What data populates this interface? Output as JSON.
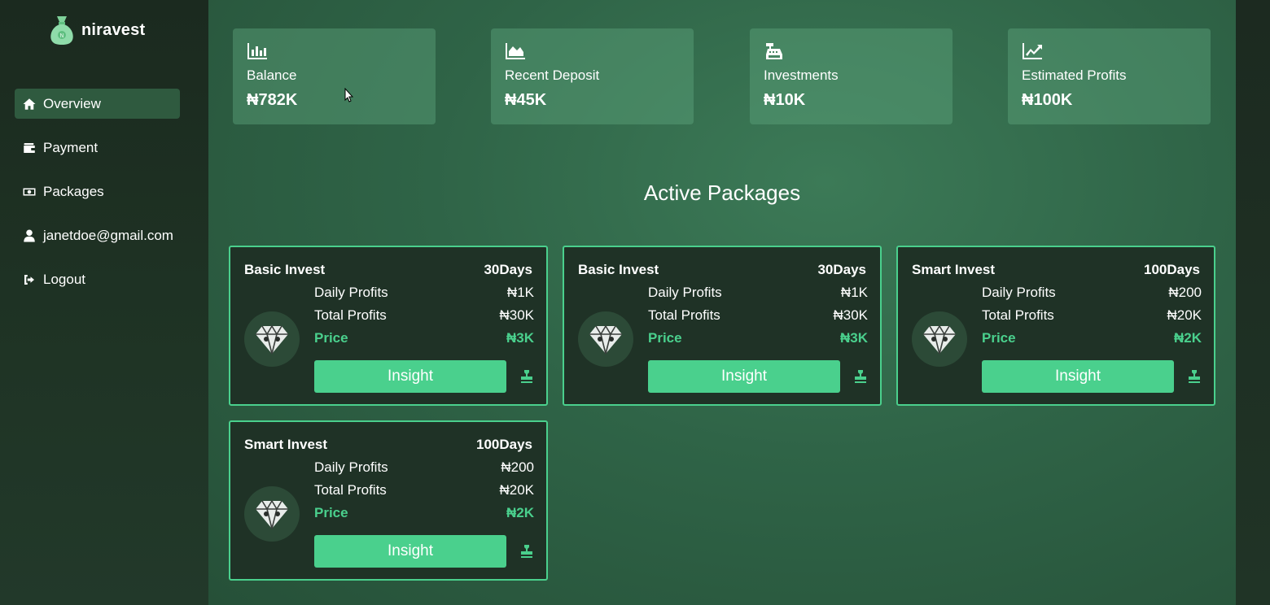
{
  "brand": {
    "name": "niravest",
    "logo_icon": "money-bag-icon"
  },
  "sidebar": {
    "items": [
      {
        "label": "Overview",
        "icon": "home-icon",
        "active": true
      },
      {
        "label": "Payment",
        "icon": "wallet-icon",
        "active": false
      },
      {
        "label": "Packages",
        "icon": "money-bill-icon",
        "active": false
      },
      {
        "label": "janetdoe@gmail.com",
        "icon": "user-icon",
        "active": false
      },
      {
        "label": "Logout",
        "icon": "logout-icon",
        "active": false
      }
    ]
  },
  "stats": [
    {
      "label": "Balance",
      "value": "₦782K",
      "icon": "bar-chart-icon"
    },
    {
      "label": "Recent Deposit",
      "value": "₦45K",
      "icon": "area-chart-icon"
    },
    {
      "label": "Investments",
      "value": "₦10K",
      "icon": "cash-register-icon"
    },
    {
      "label": "Estimated Profits",
      "value": "₦100K",
      "icon": "line-chart-icon"
    }
  ],
  "section_title": "Active Packages",
  "package_labels": {
    "daily": "Daily Profits",
    "total": "Total Profits",
    "price": "Price",
    "button": "Insight"
  },
  "packages": [
    {
      "name": "Basic Invest",
      "days": "30Days",
      "daily": "₦1K",
      "total": "₦30K",
      "price": "₦3K"
    },
    {
      "name": "Basic Invest",
      "days": "30Days",
      "daily": "₦1K",
      "total": "₦30K",
      "price": "₦3K"
    },
    {
      "name": "Smart Invest",
      "days": "100Days",
      "daily": "₦200",
      "total": "₦20K",
      "price": "₦2K"
    },
    {
      "name": "Smart Invest",
      "days": "100Days",
      "daily": "₦200",
      "total": "₦20K",
      "price": "₦2K"
    }
  ],
  "colors": {
    "accent": "#4ad08d",
    "active_nav": "#2f5a3f",
    "card_bg": "#1f3226"
  }
}
